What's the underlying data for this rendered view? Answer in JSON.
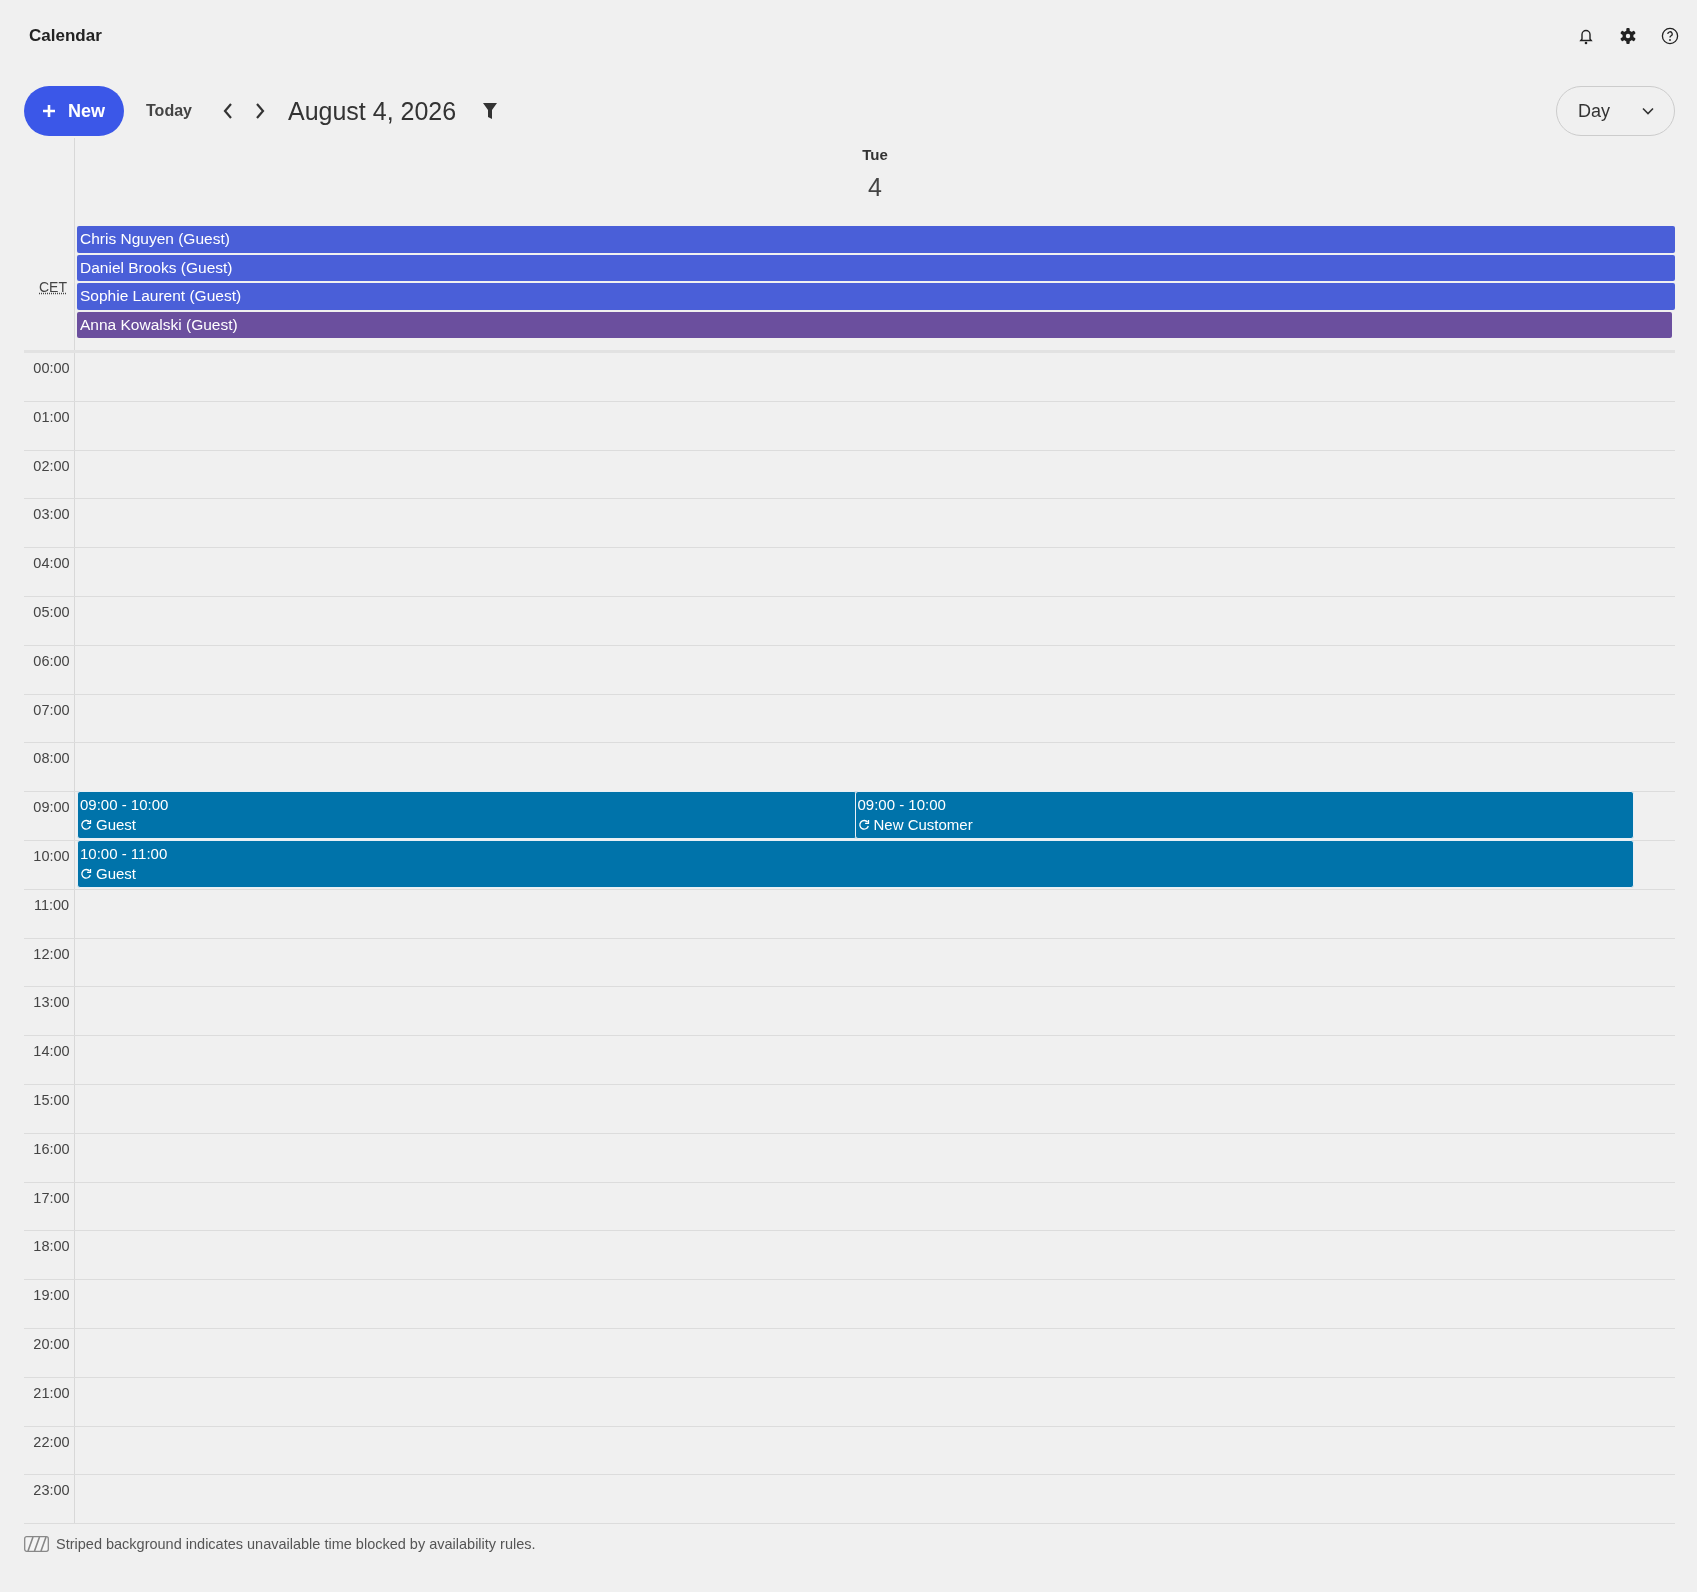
{
  "header": {
    "title": "Calendar"
  },
  "toolbar": {
    "new_button": "New",
    "today_button": "Today",
    "date": "August 4, 2026",
    "view": "Day"
  },
  "day_header": {
    "weekday": "Tue",
    "day": "4"
  },
  "timezone": "CET",
  "all_day_events": [
    {
      "title": "Chris Nguyen (Guest)",
      "color": "#4a5fd8"
    },
    {
      "title": "Daniel Brooks (Guest)",
      "color": "#4a5fd8"
    },
    {
      "title": "Sophie Laurent (Guest)",
      "color": "#4a5fd8"
    },
    {
      "title": "Anna Kowalski (Guest)",
      "color": "#6b4f9e"
    }
  ],
  "hours": [
    {
      "label": "00:00"
    },
    {
      "label": "01:00"
    },
    {
      "label": "02:00"
    },
    {
      "label": "03:00"
    },
    {
      "label": "04:00"
    },
    {
      "label": "05:00"
    },
    {
      "label": "06:00"
    },
    {
      "label": "07:00"
    },
    {
      "label": "08:00"
    },
    {
      "label": "09:00",
      "events": [
        {
          "time": "09:00 - 10:00",
          "title": "Guest",
          "recurring": true
        },
        {
          "time": "09:00 - 10:00",
          "title": "New Customer",
          "recurring": true
        }
      ]
    },
    {
      "label": "10:00",
      "events": [
        {
          "time": "10:00 - 11:00",
          "title": "Guest",
          "recurring": true
        }
      ]
    },
    {
      "label": "11:00"
    },
    {
      "label": "12:00"
    },
    {
      "label": "13:00"
    },
    {
      "label": "14:00"
    },
    {
      "label": "15:00"
    },
    {
      "label": "16:00"
    },
    {
      "label": "17:00"
    },
    {
      "label": "18:00"
    },
    {
      "label": "19:00"
    },
    {
      "label": "20:00"
    },
    {
      "label": "21:00"
    },
    {
      "label": "22:00"
    },
    {
      "label": "23:00"
    }
  ],
  "footer": {
    "note": "Striped background indicates unavailable time blocked by availability rules."
  }
}
